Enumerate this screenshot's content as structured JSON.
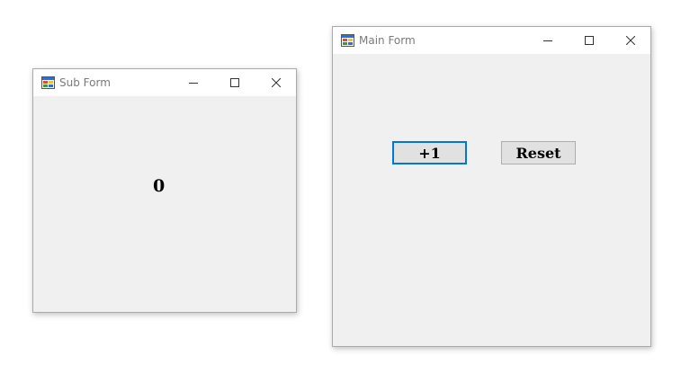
{
  "sub_form": {
    "title": "Sub Form",
    "counter_value": "0",
    "controls": [
      "minimize-icon",
      "maximize-icon",
      "close-icon"
    ]
  },
  "main_form": {
    "title": "Main Form",
    "increment_label": "+1",
    "reset_label": "Reset",
    "controls": [
      "minimize-icon",
      "maximize-icon",
      "close-icon"
    ]
  },
  "colors": {
    "window_bg": "#f0f0f0",
    "titlebar_bg": "#ffffff",
    "title_text": "#7a7a7a",
    "focus_border": "#0078d7",
    "button_bg": "#e1e1e1"
  }
}
